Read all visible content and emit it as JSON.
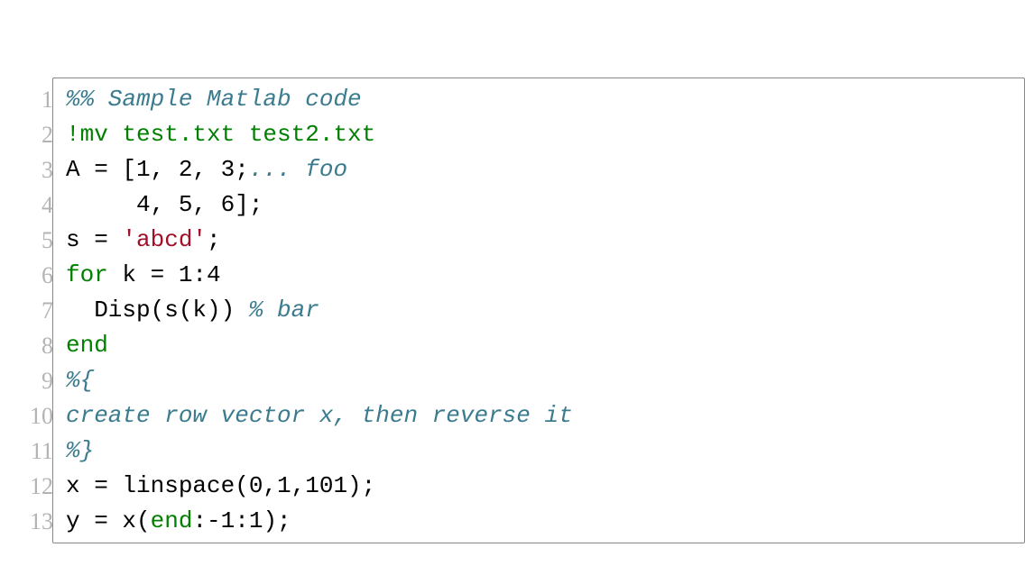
{
  "language": "Matlab",
  "colors": {
    "lineno": "#b3b3b3",
    "border": "#888888",
    "default": "#000000",
    "comment": "#3b7b8e",
    "keyword": "#007f00",
    "string": "#a01028"
  },
  "lines": [
    {
      "n": 1,
      "tokens": [
        {
          "cls": "comment",
          "t": "%% Sample Matlab code"
        }
      ]
    },
    {
      "n": 2,
      "tokens": [
        {
          "cls": "keyword",
          "t": "!mv test.txt test2.txt"
        }
      ]
    },
    {
      "n": 3,
      "tokens": [
        {
          "cls": "default",
          "t": "A = [1, 2, 3;"
        },
        {
          "cls": "comment",
          "t": "... foo"
        }
      ]
    },
    {
      "n": 4,
      "tokens": [
        {
          "cls": "default",
          "t": "     4, 5, 6];"
        }
      ]
    },
    {
      "n": 5,
      "tokens": [
        {
          "cls": "default",
          "t": "s = "
        },
        {
          "cls": "string",
          "t": "'abcd'"
        },
        {
          "cls": "default",
          "t": ";"
        }
      ]
    },
    {
      "n": 6,
      "tokens": [
        {
          "cls": "keyword",
          "t": "for"
        },
        {
          "cls": "default",
          "t": " k = 1:4"
        }
      ]
    },
    {
      "n": 7,
      "tokens": [
        {
          "cls": "default",
          "t": "  Disp(s(k)) "
        },
        {
          "cls": "comment",
          "t": "% bar"
        }
      ]
    },
    {
      "n": 8,
      "tokens": [
        {
          "cls": "keyword",
          "t": "end"
        }
      ]
    },
    {
      "n": 9,
      "tokens": [
        {
          "cls": "comment",
          "t": "%{"
        }
      ]
    },
    {
      "n": 10,
      "tokens": [
        {
          "cls": "comment",
          "t": "create row vector x, then reverse it"
        }
      ]
    },
    {
      "n": 11,
      "tokens": [
        {
          "cls": "comment",
          "t": "%}"
        }
      ]
    },
    {
      "n": 12,
      "tokens": [
        {
          "cls": "default",
          "t": "x = linspace(0,1,101);"
        }
      ]
    },
    {
      "n": 13,
      "tokens": [
        {
          "cls": "default",
          "t": "y = x("
        },
        {
          "cls": "keyword",
          "t": "end"
        },
        {
          "cls": "default",
          "t": ":-1:1);"
        }
      ]
    }
  ]
}
